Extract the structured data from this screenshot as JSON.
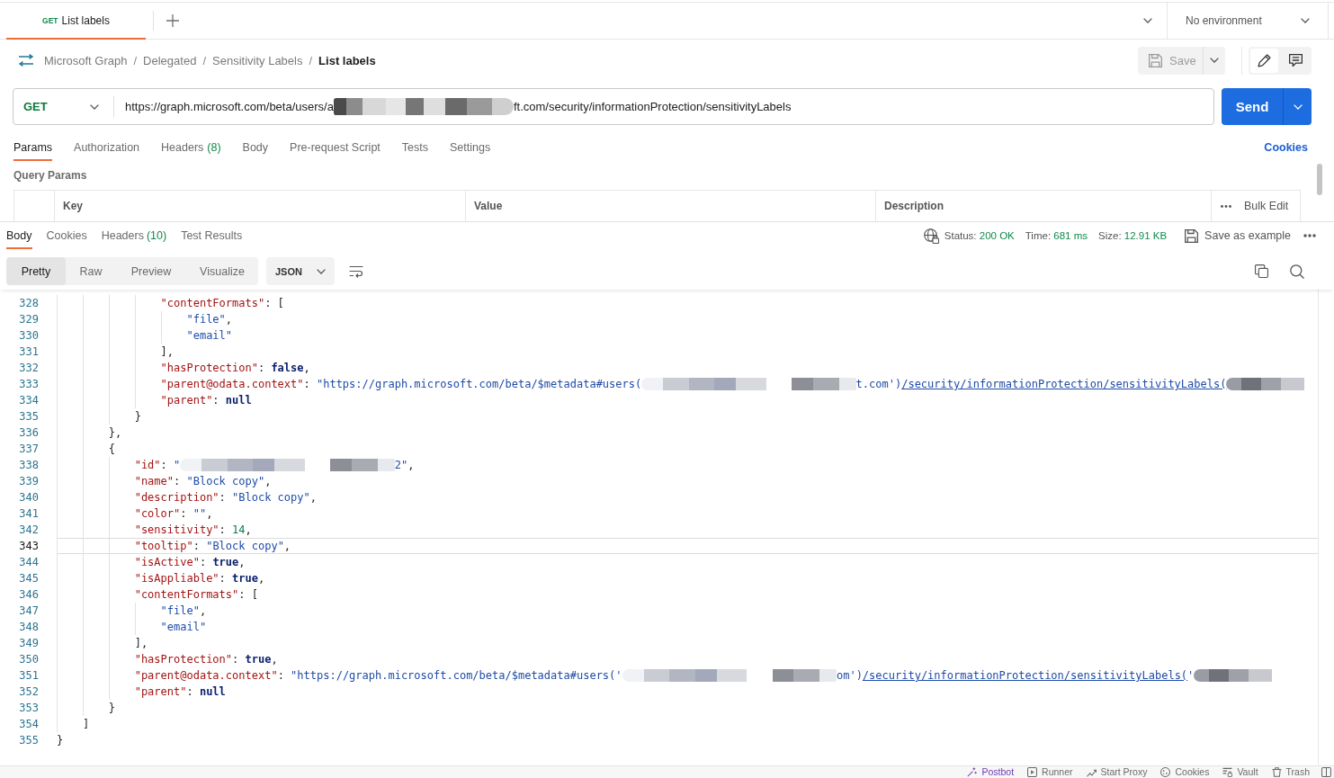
{
  "tabs": [
    {
      "method": "GET",
      "label": "List labels",
      "selected": true
    }
  ],
  "environment": {
    "label": "No environment"
  },
  "breadcrumb": [
    {
      "label": "Microsoft Graph",
      "separator": "/",
      "current": false
    },
    {
      "label": "Delegated",
      "separator": "/",
      "current": false
    },
    {
      "label": "Sensitivity Labels",
      "separator": "/",
      "current": false
    },
    {
      "label": "List labels",
      "current": true
    }
  ],
  "save": {
    "label": "Save",
    "disabled": true
  },
  "view_toggle": [
    {
      "kind": "edit",
      "selected": true
    },
    {
      "kind": "comments",
      "selected": false
    }
  ],
  "request": {
    "method": "GET",
    "url_start": "https://graph.microsoft.com/beta/users/a",
    "url_end": "ft.com/security/informationProtection/sensitivityLabels",
    "send": "Send"
  },
  "request_tabs": [
    {
      "label": "Params",
      "selected": true
    },
    {
      "label": "Authorization",
      "selected": false
    },
    {
      "label": "Headers",
      "count": "(8)",
      "selected": false
    },
    {
      "label": "Body",
      "selected": false
    },
    {
      "label": "Pre-request Script",
      "selected": false
    },
    {
      "label": "Tests",
      "selected": false
    },
    {
      "label": "Settings",
      "selected": false
    }
  ],
  "cookies_link": "Cookies",
  "query_params": {
    "title": "Query Params",
    "columns": [
      "Key",
      "Value",
      "Description"
    ],
    "bulk_edit": "Bulk Edit"
  },
  "response": {
    "tabs": [
      {
        "label": "Body",
        "selected": true
      },
      {
        "label": "Cookies",
        "selected": false
      },
      {
        "label": "Headers",
        "count": "(10)",
        "selected": false
      },
      {
        "label": "Test Results",
        "selected": false
      }
    ],
    "meta": [
      {
        "label": "Status:",
        "value": "200 OK"
      },
      {
        "label": "Time:",
        "value": "681 ms"
      },
      {
        "label": "Size:",
        "value": "12.91 KB"
      }
    ],
    "save_example": "Save as example",
    "view_modes": [
      {
        "label": "Pretty",
        "selected": true
      },
      {
        "label": "Raw",
        "selected": false
      },
      {
        "label": "Preview",
        "selected": false
      },
      {
        "label": "Visualize",
        "selected": false
      }
    ],
    "format": "JSON"
  },
  "code_lines": [
    {
      "number": "328",
      "selected": false,
      "tokens": [
        {
          "kind": "key",
          "text": "                \"contentFormats\""
        },
        {
          "kind": "punct",
          "text": ": ["
        }
      ]
    },
    {
      "number": "329",
      "selected": false,
      "tokens": [
        {
          "kind": "string",
          "text": "                    \"file\""
        },
        {
          "kind": "punct",
          "text": ","
        }
      ]
    },
    {
      "number": "330",
      "selected": false,
      "tokens": [
        {
          "kind": "string",
          "text": "                    \"email\""
        }
      ]
    },
    {
      "number": "331",
      "selected": false,
      "tokens": [
        {
          "kind": "punct",
          "text": "                ],"
        }
      ]
    },
    {
      "number": "332",
      "selected": false,
      "tokens": [
        {
          "kind": "key",
          "text": "                \"hasProtection\""
        },
        {
          "kind": "punct",
          "text": ": "
        },
        {
          "kind": "keyword",
          "text": "false"
        },
        {
          "kind": "punct",
          "text": ","
        }
      ]
    },
    {
      "number": "333",
      "selected": false,
      "tokens": [
        {
          "kind": "key",
          "text": "                \"parent@odata.context\""
        },
        {
          "kind": "punct",
          "text": ": "
        },
        {
          "kind": "string",
          "text": "\"https://graph.microsoft.com/beta/$metadata#users("
        },
        {
          "kind": "redacted"
        },
        {
          "kind": "string",
          "text": "t.com')"
        },
        {
          "kind": "link",
          "text": "/security/informationProtection/sensitivityLabels("
        },
        {
          "kind": "redacted"
        }
      ]
    },
    {
      "number": "334",
      "selected": false,
      "tokens": [
        {
          "kind": "key",
          "text": "                \"parent\""
        },
        {
          "kind": "punct",
          "text": ": "
        },
        {
          "kind": "keyword",
          "text": "null"
        }
      ]
    },
    {
      "number": "335",
      "selected": false,
      "tokens": [
        {
          "kind": "punct",
          "text": "            }"
        }
      ]
    },
    {
      "number": "336",
      "selected": false,
      "tokens": [
        {
          "kind": "punct",
          "text": "        },"
        }
      ]
    },
    {
      "number": "337",
      "selected": false,
      "tokens": [
        {
          "kind": "punct",
          "text": "        {"
        }
      ]
    },
    {
      "number": "338",
      "selected": false,
      "tokens": [
        {
          "kind": "key",
          "text": "            \"id\""
        },
        {
          "kind": "punct",
          "text": ": "
        },
        {
          "kind": "string",
          "text": "\""
        },
        {
          "kind": "redacted"
        },
        {
          "kind": "string",
          "text": "2\""
        },
        {
          "kind": "punct",
          "text": ","
        }
      ]
    },
    {
      "number": "339",
      "selected": false,
      "tokens": [
        {
          "kind": "key",
          "text": "            \"name\""
        },
        {
          "kind": "punct",
          "text": ": "
        },
        {
          "kind": "string",
          "text": "\"Block copy\""
        },
        {
          "kind": "punct",
          "text": ","
        }
      ]
    },
    {
      "number": "340",
      "selected": false,
      "tokens": [
        {
          "kind": "key",
          "text": "            \"description\""
        },
        {
          "kind": "punct",
          "text": ": "
        },
        {
          "kind": "string",
          "text": "\"Block copy\""
        },
        {
          "kind": "punct",
          "text": ","
        }
      ]
    },
    {
      "number": "341",
      "selected": false,
      "tokens": [
        {
          "kind": "key",
          "text": "            \"color\""
        },
        {
          "kind": "punct",
          "text": ": "
        },
        {
          "kind": "string",
          "text": "\"\""
        },
        {
          "kind": "punct",
          "text": ","
        }
      ]
    },
    {
      "number": "342",
      "selected": false,
      "tokens": [
        {
          "kind": "key",
          "text": "            \"sensitivity\""
        },
        {
          "kind": "punct",
          "text": ": "
        },
        {
          "kind": "number",
          "text": "14"
        },
        {
          "kind": "punct",
          "text": ","
        }
      ]
    },
    {
      "number": "343",
      "selected": true,
      "tokens": [
        {
          "kind": "key",
          "text": "            \"tooltip\""
        },
        {
          "kind": "punct",
          "text": ": "
        },
        {
          "kind": "string",
          "text": "\"Block copy\""
        },
        {
          "kind": "punct",
          "text": ","
        }
      ]
    },
    {
      "number": "344",
      "selected": false,
      "tokens": [
        {
          "kind": "key",
          "text": "            \"isActive\""
        },
        {
          "kind": "punct",
          "text": ": "
        },
        {
          "kind": "keyword",
          "text": "true"
        },
        {
          "kind": "punct",
          "text": ","
        }
      ]
    },
    {
      "number": "345",
      "selected": false,
      "tokens": [
        {
          "kind": "key",
          "text": "            \"isAppliable\""
        },
        {
          "kind": "punct",
          "text": ": "
        },
        {
          "kind": "keyword",
          "text": "true"
        },
        {
          "kind": "punct",
          "text": ","
        }
      ]
    },
    {
      "number": "346",
      "selected": false,
      "tokens": [
        {
          "kind": "key",
          "text": "            \"contentFormats\""
        },
        {
          "kind": "punct",
          "text": ": ["
        }
      ]
    },
    {
      "number": "347",
      "selected": false,
      "tokens": [
        {
          "kind": "string",
          "text": "                \"file\""
        },
        {
          "kind": "punct",
          "text": ","
        }
      ]
    },
    {
      "number": "348",
      "selected": false,
      "tokens": [
        {
          "kind": "string",
          "text": "                \"email\""
        }
      ]
    },
    {
      "number": "349",
      "selected": false,
      "tokens": [
        {
          "kind": "punct",
          "text": "            ],"
        }
      ]
    },
    {
      "number": "350",
      "selected": false,
      "tokens": [
        {
          "kind": "key",
          "text": "            \"hasProtection\""
        },
        {
          "kind": "punct",
          "text": ": "
        },
        {
          "kind": "keyword",
          "text": "true"
        },
        {
          "kind": "punct",
          "text": ","
        }
      ]
    },
    {
      "number": "351",
      "selected": false,
      "tokens": [
        {
          "kind": "key",
          "text": "            \"parent@odata.context\""
        },
        {
          "kind": "punct",
          "text": ": "
        },
        {
          "kind": "string",
          "text": "\"https://graph.microsoft.com/beta/$metadata#users('"
        },
        {
          "kind": "redacted"
        },
        {
          "kind": "string",
          "text": "om')"
        },
        {
          "kind": "link",
          "text": "/security/informationProtection/sensitivityLabels("
        },
        {
          "kind": "string",
          "text": "'"
        },
        {
          "kind": "redacted"
        }
      ]
    },
    {
      "number": "352",
      "selected": false,
      "tokens": [
        {
          "kind": "key",
          "text": "            \"parent\""
        },
        {
          "kind": "punct",
          "text": ": "
        },
        {
          "kind": "keyword",
          "text": "null"
        }
      ]
    },
    {
      "number": "353",
      "selected": false,
      "tokens": [
        {
          "kind": "punct",
          "text": "        }"
        }
      ]
    },
    {
      "number": "354",
      "selected": false,
      "tokens": [
        {
          "kind": "punct",
          "text": "    ]"
        }
      ]
    },
    {
      "number": "355",
      "selected": false,
      "tokens": [
        {
          "kind": "punct",
          "text": "}"
        }
      ]
    }
  ],
  "status_bar": [
    {
      "kind": "postbot",
      "label": "Postbot"
    },
    {
      "kind": "runner",
      "label": "Runner"
    },
    {
      "kind": "proxy",
      "label": "Start Proxy"
    },
    {
      "kind": "cookies",
      "label": "Cookies"
    },
    {
      "kind": "vault",
      "label": "Vault"
    },
    {
      "kind": "trash",
      "label": "Trash"
    }
  ]
}
